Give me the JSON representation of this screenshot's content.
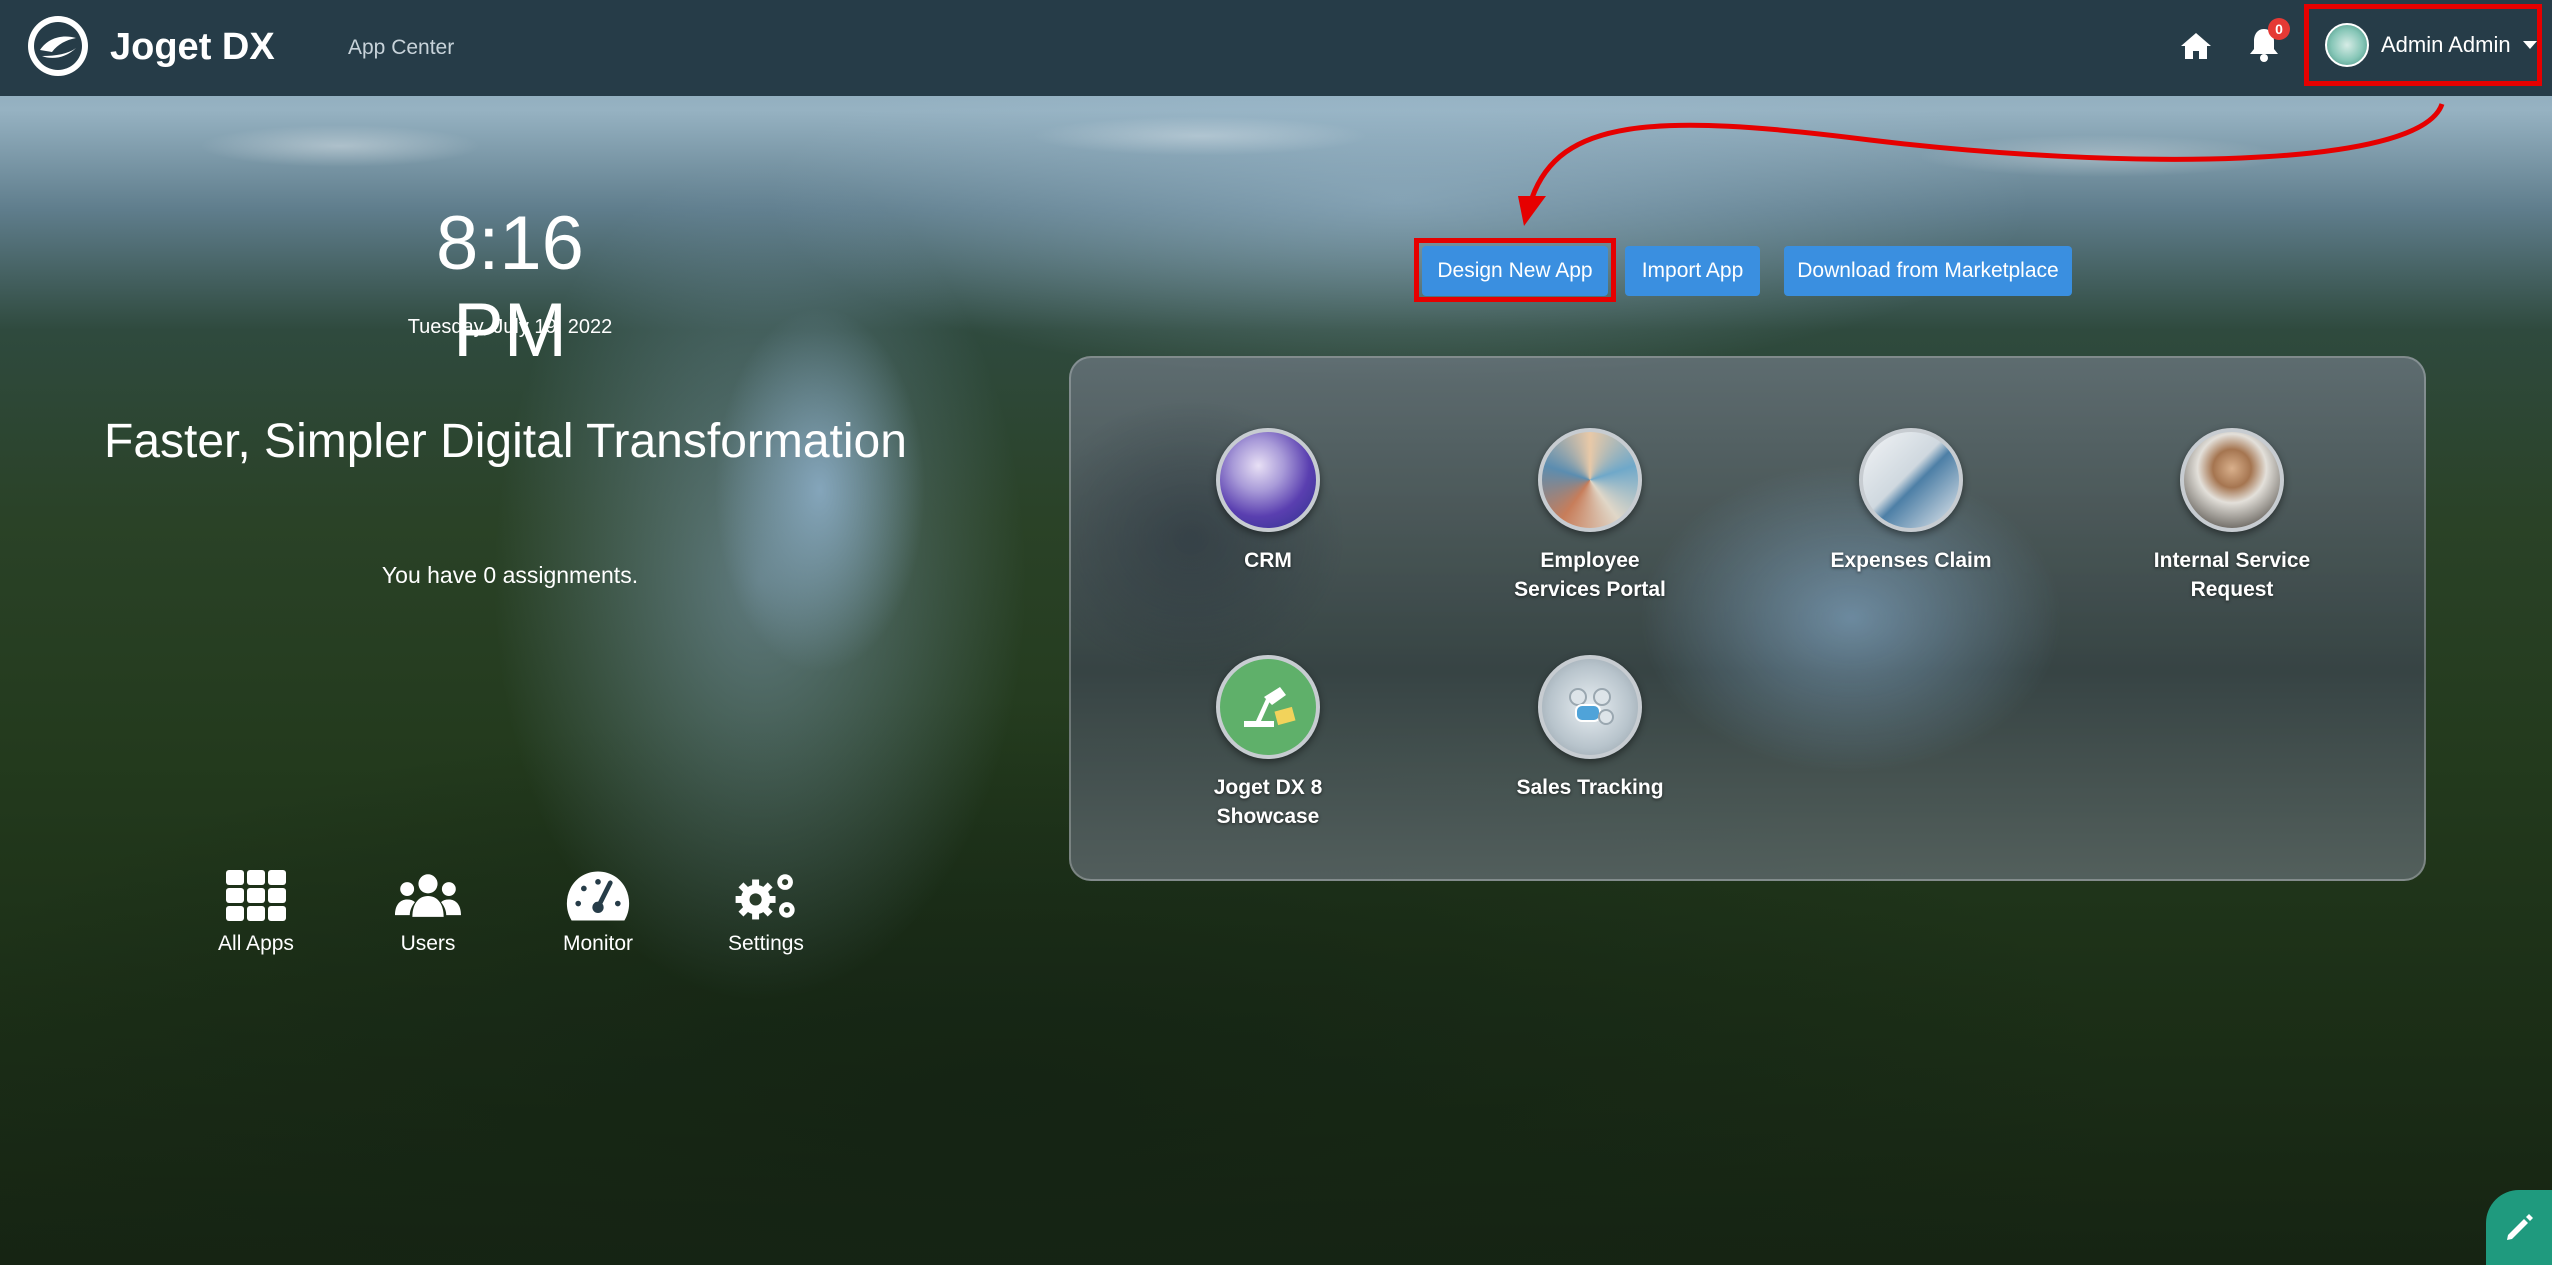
{
  "header": {
    "brand": "Joget DX",
    "section": "App Center",
    "notification_count": "0",
    "user_name": "Admin Admin"
  },
  "clock": {
    "time": "8:16 PM",
    "date": "Tuesday, July 19, 2022"
  },
  "tagline": "Faster, Simpler Digital Transformation",
  "assignments_text": "You have 0 assignments.",
  "actions": {
    "design_new_app": "Design New App",
    "import_app": "Import App",
    "download_marketplace": "Download from Marketplace"
  },
  "apps": [
    {
      "label": "CRM",
      "icon": "crm-app-icon"
    },
    {
      "label": "Employee\nServices Portal",
      "icon": "employee-portal-app-icon"
    },
    {
      "label": "Expenses Claim",
      "icon": "expenses-claim-app-icon"
    },
    {
      "label": "Internal Service\nRequest",
      "icon": "internal-service-app-icon"
    },
    {
      "label": "Joget DX 8\nShowcase",
      "icon": "showcase-app-icon"
    },
    {
      "label": "Sales Tracking",
      "icon": "sales-tracking-app-icon"
    }
  ],
  "shortcuts": {
    "all_apps": "All Apps",
    "users": "Users",
    "monitor": "Monitor",
    "settings": "Settings"
  },
  "colors": {
    "topbar": "#263c48",
    "button": "#3a8fe0",
    "annotation": "#e60000",
    "fab": "#1f9a7e"
  }
}
